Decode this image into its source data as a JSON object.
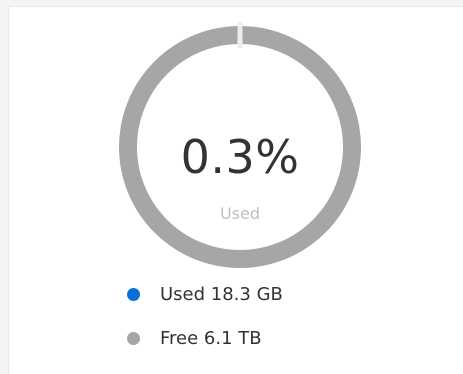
{
  "widget": {
    "percent_text": "0.3%",
    "percent_sublabel": "Used",
    "used_fraction": 0.003
  },
  "legend": [
    {
      "label": "Used 18.3 GB",
      "color": "#0b6fd6"
    },
    {
      "label": "Free 6.1 TB",
      "color": "#a6a6a6"
    }
  ],
  "colors": {
    "ring_free": "#a6a6a6",
    "ring_used": "#0b6fd6",
    "segment_gap": "#e8eef3"
  }
}
